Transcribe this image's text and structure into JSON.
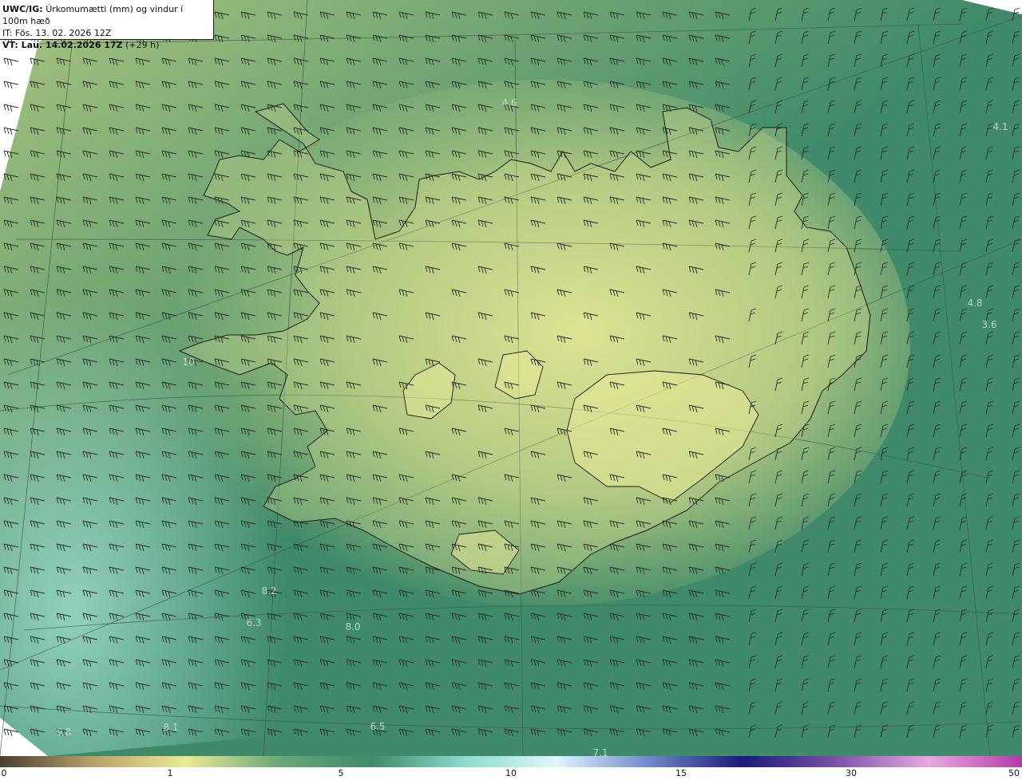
{
  "title": {
    "prefix": "UWC/IG:",
    "text": "Úrkomumætti (mm) og vindur í 100m hæð",
    "init_time": "IT: Fös. 13. 02. 2026 12Z",
    "valid_label": "VT: Lau. 14.02.2026 17Z",
    "lead": "(+29 h)"
  },
  "colors": {
    "land_bright": "#eaea96",
    "land_mid": "#a8c47e",
    "sea_deep": "#3f8a6a",
    "sea_light": "#a8e6da",
    "coastline": "#1a1a1a",
    "barb": "#2a2a2a"
  },
  "map_labels": [
    {
      "value": "4.6"
    },
    {
      "value": "4.1"
    },
    {
      "value": "4.8"
    },
    {
      "value": "3.6"
    },
    {
      "value": "8.2"
    },
    {
      "value": "6.3"
    },
    {
      "value": "8.0"
    },
    {
      "value": "9.8"
    },
    {
      "value": "8.1"
    },
    {
      "value": "6.5"
    },
    {
      "value": "7.1"
    },
    {
      "value": "10"
    }
  ],
  "colorbar": {
    "stops": [
      "#4a3e30",
      "#b8a068",
      "#eaea96",
      "#6aa878",
      "#3f8a6a",
      "#8adcd0",
      "#dff5ff",
      "#6f86c8",
      "#1a1a78",
      "#7a52a8",
      "#e8a8e0",
      "#b63aa8"
    ],
    "ticks": [
      "0",
      "1",
      "5",
      "10",
      "15",
      "30",
      "50"
    ]
  }
}
